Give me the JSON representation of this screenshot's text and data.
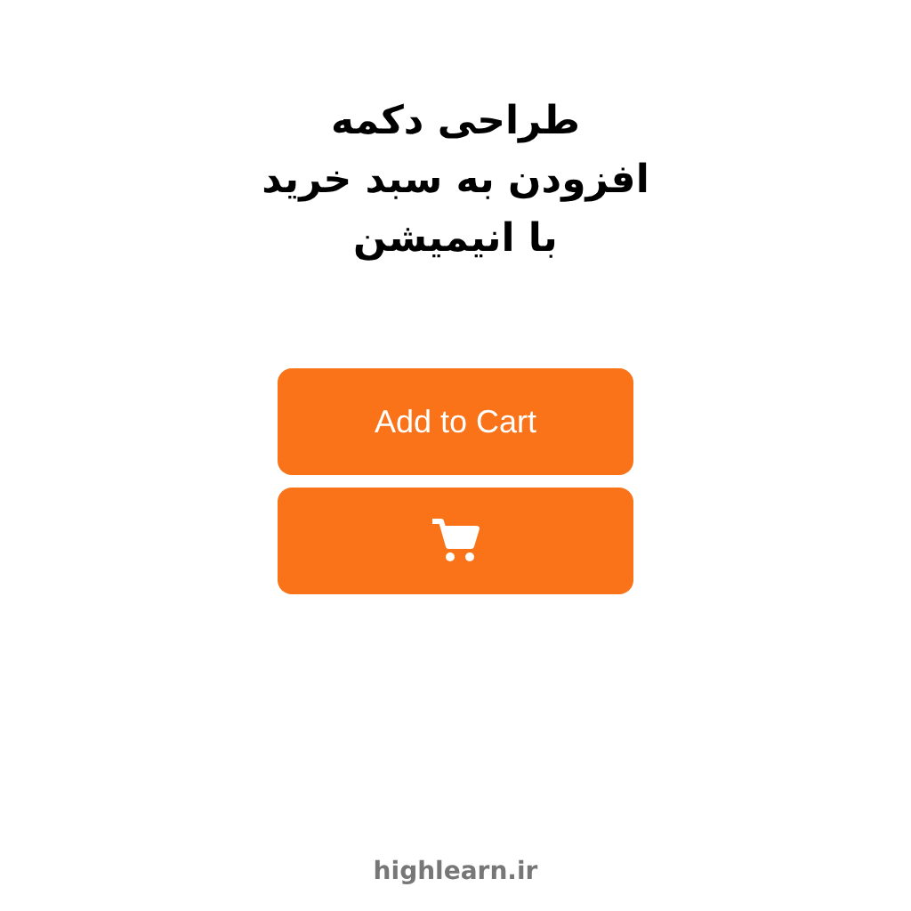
{
  "title": {
    "lines": [
      "طراحی دکمه",
      "افزودن به سبد خرید",
      "با انیمیشن"
    ]
  },
  "buttons": [
    {
      "kind": "text",
      "label": "Add to Cart"
    },
    {
      "kind": "icon"
    }
  ],
  "footer": "highlearn.ir"
}
